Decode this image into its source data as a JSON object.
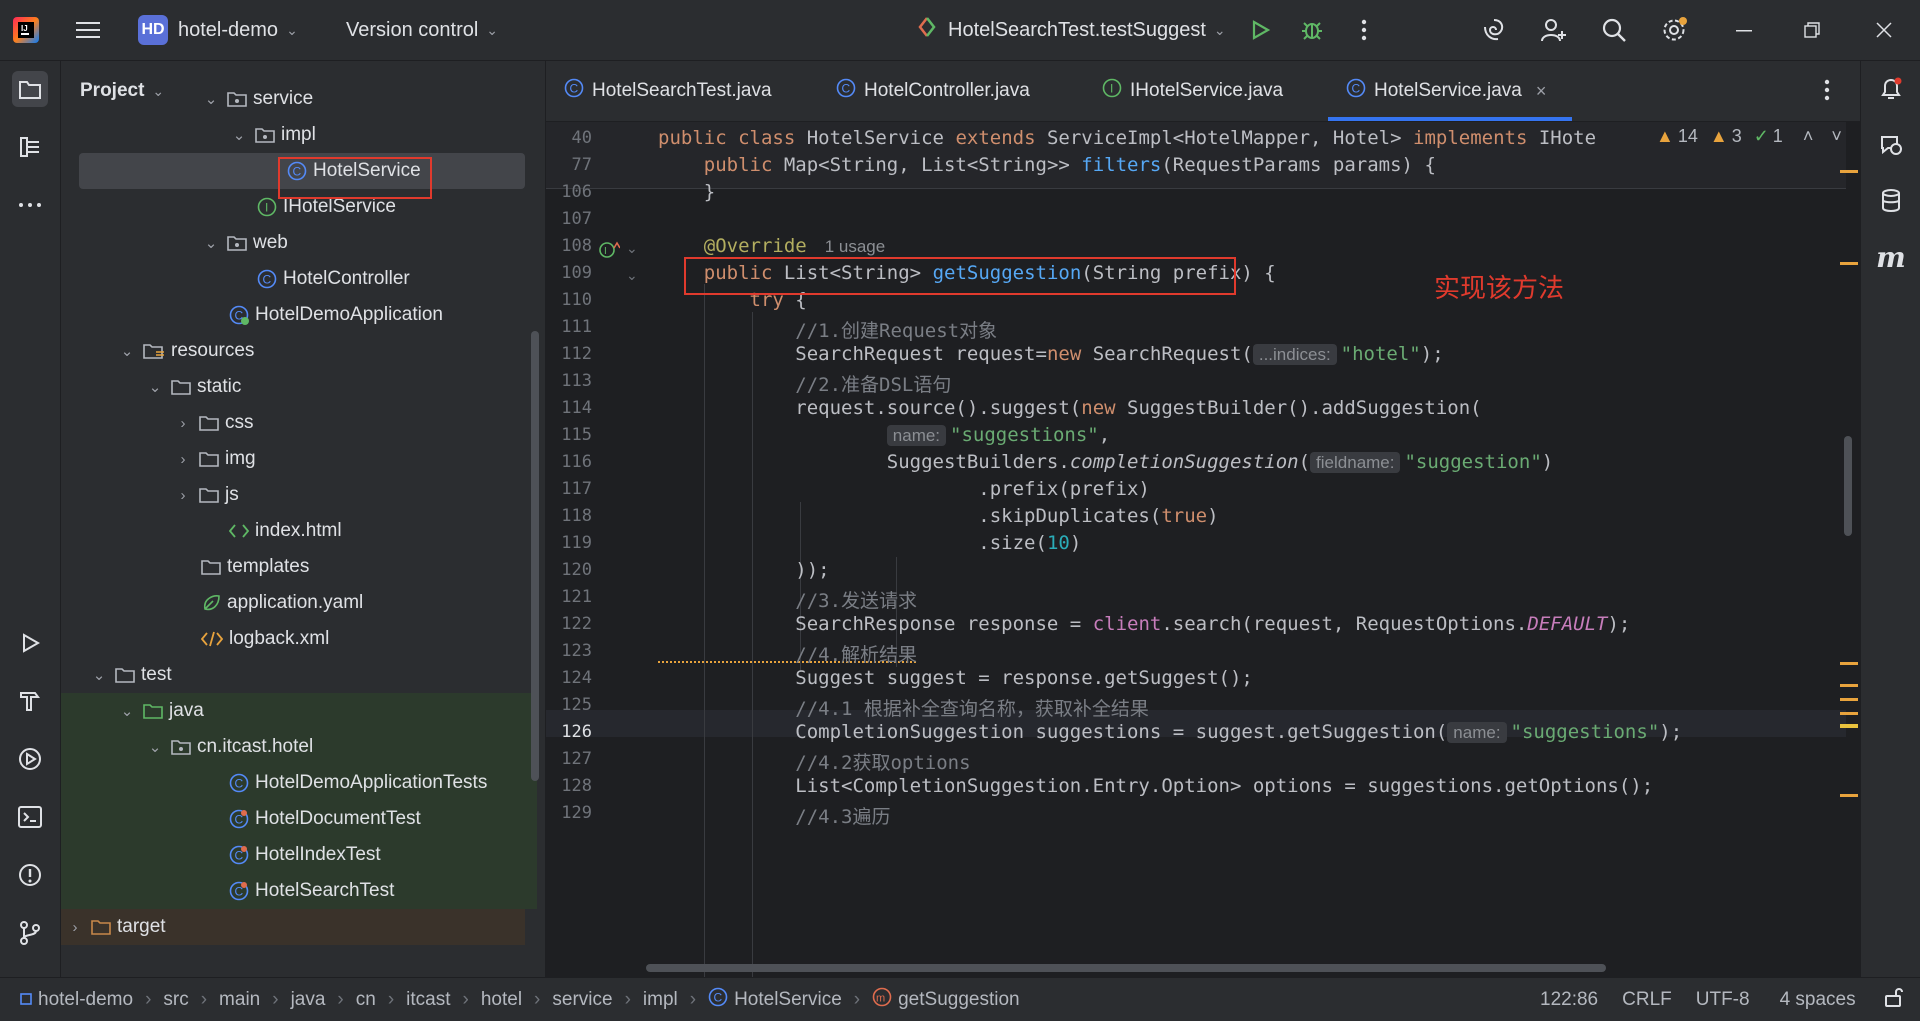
{
  "title_bar": {
    "project_badge": "HD",
    "project_name": "hotel-demo",
    "vcs_label": "Version control",
    "run_config": "HotelSearchTest.testSuggest"
  },
  "project_panel": {
    "title": "Project",
    "rows": [
      {
        "label": "service"
      },
      {
        "label": "impl"
      },
      {
        "label": "HotelService"
      },
      {
        "label": "IHotelService"
      },
      {
        "label": "web"
      },
      {
        "label": "HotelController"
      },
      {
        "label": "HotelDemoApplication"
      },
      {
        "label": "resources"
      },
      {
        "label": "static"
      },
      {
        "label": "css"
      },
      {
        "label": "img"
      },
      {
        "label": "js"
      },
      {
        "label": "index.html"
      },
      {
        "label": "templates"
      },
      {
        "label": "application.yaml"
      },
      {
        "label": "logback.xml"
      },
      {
        "label": "test"
      },
      {
        "label": "java"
      },
      {
        "label": "cn.itcast.hotel"
      },
      {
        "label": "HotelDemoApplicationTests"
      },
      {
        "label": "HotelDocumentTest"
      },
      {
        "label": "HotelIndexTest"
      },
      {
        "label": "HotelSearchTest"
      },
      {
        "label": "target"
      }
    ]
  },
  "tabs": [
    {
      "label": "HotelSearchTest.java"
    },
    {
      "label": "HotelController.java"
    },
    {
      "label": "IHotelService.java"
    },
    {
      "label": "HotelService.java"
    }
  ],
  "editor": {
    "inspection_counts": {
      "warnings": "14",
      "weak_warnings": "3",
      "ok": "1"
    },
    "line_numbers": [
      "40",
      "77",
      "106",
      "107",
      "108",
      "109",
      "110",
      "111",
      "112",
      "113",
      "114",
      "115",
      "116",
      "117",
      "118",
      "119",
      "120",
      "121",
      "122",
      "123",
      "124",
      "125",
      "126",
      "127",
      "128",
      "129"
    ],
    "sticky_1_a": "public class ",
    "sticky_1_b": "HotelService ",
    "sticky_1_c": "extends ",
    "sticky_1_d": "ServiceImpl<HotelMapper, Hotel> ",
    "sticky_1_e": "implements ",
    "sticky_1_f": "IHote",
    "sticky_2_a": "    public ",
    "sticky_2_b": "Map<String, List<String>> ",
    "sticky_2_c": "filters",
    "sticky_2_d": "(RequestParams params) {",
    "l106": "    }",
    "l108_a": "    @Override",
    "l108_usage": "1 usage",
    "l109_a": "    public ",
    "l109_b": "List<String> ",
    "l109_c": "getSuggestion",
    "l109_d": "(String prefix) {",
    "l110_a": "        try",
    "l110_b": " {",
    "l111": "            //1.创建Request对象",
    "l112_a": "            SearchRequest request=",
    "l112_b": "new ",
    "l112_c": "SearchRequest(",
    "l112_hint": "...indices:",
    "l112_d": "\"hotel\"",
    "l112_e": ");",
    "l113": "            //2.准备DSL语句",
    "l114_a": "            request.source().suggest(",
    "l114_b": "new ",
    "l114_c": "SuggestBuilder().addSuggestion(",
    "l115_a": "                    ",
    "l115_hint": "name:",
    "l115_b": "\"suggestions\"",
    "l115_c": ",",
    "l116_a": "                    SuggestBuilders.",
    "l116_b": "completionSuggestion",
    "l116_c": "(",
    "l116_hint": "fieldname:",
    "l116_d": "\"suggestion\"",
    "l116_e": ")",
    "l117": "                            .prefix(prefix)",
    "l118_a": "                            .skipDuplicates(",
    "l118_b": "true",
    "l118_c": ")",
    "l119_a": "                            .size(",
    "l119_b": "10",
    "l119_c": ")",
    "l120": "            ));",
    "l121": "            //3.发送请求",
    "l122_a": "            SearchResponse response = ",
    "l122_b": "client",
    "l122_c": ".search(request, RequestOptions.",
    "l122_d": "DEFAULT",
    "l122_e": ");",
    "l123": "            //4.解析结果",
    "l124": "            Suggest suggest = response.getSuggest();",
    "l125": "            //4.1 根据补全查询名称，获取补全结果",
    "l126_a": "            CompletionSuggestion suggestions = suggest.getSuggestion(",
    "l126_hint": "name:",
    "l126_b": "\"suggestions\"",
    "l126_c": ");",
    "l127": "            //4.2获取options",
    "l128": "            List<CompletionSuggestion.Entry.Option> options = suggestions.getOptions();",
    "l129": "            //4.3遍历",
    "annotation_text": "实现该方法",
    "annotation_color": "#e03a2d"
  },
  "status_bar": {
    "crumbs": [
      "hotel-demo",
      "src",
      "main",
      "java",
      "cn",
      "itcast",
      "hotel",
      "service",
      "impl",
      "HotelService",
      "getSuggestion"
    ],
    "position": "122:86",
    "line_sep": "CRLF",
    "encoding": "UTF-8",
    "indent": "4 spaces"
  },
  "colors": {
    "accent": "#3574f0",
    "annotation_red": "#e03a2d",
    "warning": "#e8a33d"
  }
}
